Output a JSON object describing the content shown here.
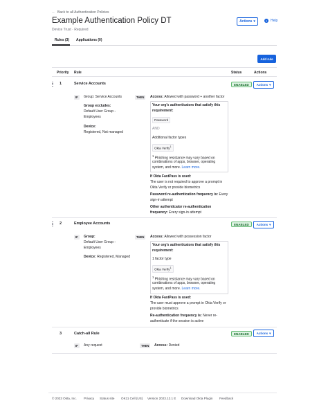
{
  "header": {
    "back_label": "Back to all Authentication Policies",
    "title": "Example Authentication Policy DT",
    "subtitle": "Device Trust · Required",
    "actions_label": "Actions",
    "help_label": "Help"
  },
  "tabs": [
    {
      "label": "Rules (3)"
    },
    {
      "label": "Applications (0)"
    }
  ],
  "add_rule_label": "Add rule",
  "table": {
    "col_priority": "Priority",
    "col_rule": "Rule",
    "col_status": "Status",
    "col_actions": "Actions"
  },
  "rules": [
    {
      "priority": "1",
      "name": "Service Accounts",
      "status": "ENABLED",
      "actions_label": "Actions",
      "if_tag": "IF",
      "then_tag": "THEN",
      "group_line": "Group: Service Accounts",
      "group_excludes_label": "Group excludes:",
      "group_excludes_value_1": "Default User Group -",
      "group_excludes_value_2": "Employees",
      "device_label": "Device:",
      "device_value": "Registered, Not managed",
      "access_label": "Access:",
      "access_value": "Allowed with password + another factor",
      "box_heading_1": "Your org's authenticators that satisfy this",
      "box_heading_2": "requirement:",
      "chip_1": "Password",
      "and_label": "AND",
      "additional_label": "Additional factor types",
      "chip_2": "Okta Verify",
      "footnote_mark": "1",
      "note_1": "Phishing resistance may vary based on",
      "note_2": "combinations of apps, browser, operating",
      "note_3": "system, and more.",
      "learn_more": "Learn more.",
      "fastpass_label": "If Okta FastPass is used:",
      "fastpass_1": "The user is not required to approve a prompt in",
      "fastpass_2": "Okta Verify or provide biometrics",
      "reauth_label": "Password re-authentication frequency is:",
      "reauth_value_1": "Every",
      "reauth_value_2": "sign-in attempt",
      "other_label_1": "Other authenticator re-authentication",
      "other_label_2": "frequency:",
      "other_value": "Every sign-in attempt"
    },
    {
      "priority": "2",
      "name": "Employee Accounts",
      "status": "ENABLED",
      "actions_label": "Actions",
      "if_tag": "IF",
      "then_tag": "THEN",
      "group_label": "Group:",
      "group_value_1": "Default User Group -",
      "group_value_2": "Employees",
      "device_label": "Device:",
      "device_value": "Registered, Managed",
      "access_label": "Access:",
      "access_value": "Allowed with possession factor",
      "box_heading_1": "Your org's authenticators that satisfy this",
      "box_heading_2": "requirement:",
      "factor_type": "1 factor type",
      "chip_1": "Okta Verify",
      "footnote_mark": "1",
      "note_1": "Phishing resistance may vary based on",
      "note_2": "combinations of apps, browser, operating",
      "note_3": "system, and more.",
      "learn_more": "Learn more.",
      "fastpass_label": "If Okta FastPass is used:",
      "fastpass_1": "The user must approve a prompt in Okta Verify or",
      "fastpass_2": "provide biometrics",
      "reauth_label": "Re-authentication frequency is:",
      "reauth_value_1": "Never re-",
      "reauth_value_2": "authenticate if the session is active"
    },
    {
      "priority": "3",
      "name": "Catch-all Rule",
      "status": "ENABLED",
      "actions_label": "Actions",
      "if_tag": "IF",
      "then_tag": "THEN",
      "condition": "Any request",
      "access_label": "Access:",
      "access_value": "Denied"
    }
  ],
  "footer": {
    "copyright": "© 2023 Okta, Inc.",
    "privacy": "Privacy",
    "status_site": "Status site",
    "cell": "OK11 Cell (US)",
    "version": "Version 2023.12.1 E",
    "plugin": "Download Okta Plugin",
    "feedback": "Feedback"
  },
  "colors": {
    "accent": "#1662dd",
    "enabled_bg": "#dff3e4",
    "enabled_text": "#1b6d2e"
  }
}
